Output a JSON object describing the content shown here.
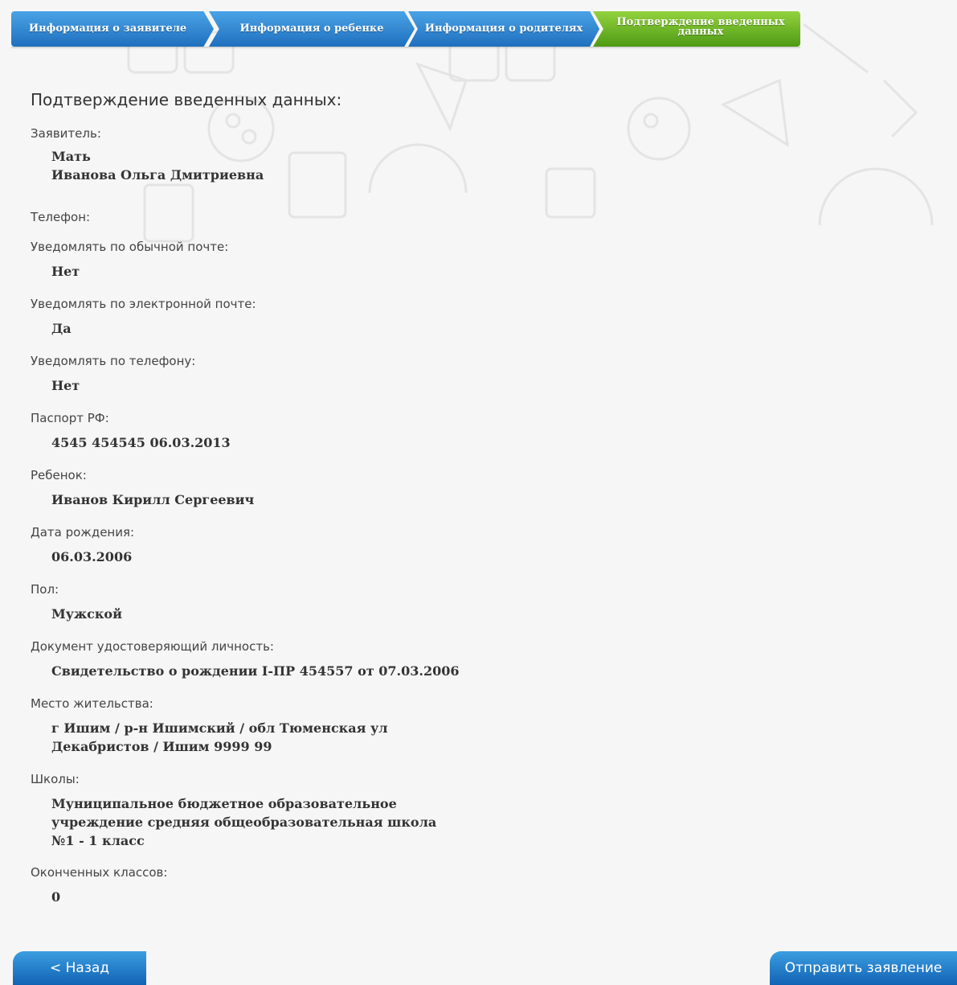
{
  "wizard": {
    "steps": [
      {
        "label": "Информация о заявителе",
        "state": "done",
        "color": "#1f6fbe"
      },
      {
        "label": "Информация о ребенке",
        "state": "done",
        "color": "#1f6fbe"
      },
      {
        "label": "Информация о родителях",
        "state": "done",
        "color": "#1f6fbe"
      },
      {
        "label": "Подтверждение введенных\nданных",
        "state": "active",
        "color": "#4e9a14"
      }
    ]
  },
  "page_title": "Подтверждение введенных данных:",
  "fields": [
    {
      "label": "Заявитель:",
      "value": "Мать\nИванова Ольга Дмитриевна"
    },
    {
      "label": "Телефон:",
      "value": ""
    },
    {
      "label": "Уведомлять по обычной почте:",
      "value": "Нет"
    },
    {
      "label": "Уведомлять по электронной почте:",
      "value": "Да"
    },
    {
      "label": "Уведомлять по телефону:",
      "value": "Нет"
    },
    {
      "label": "Паспорт РФ:",
      "value": "4545 454545 06.03.2013"
    },
    {
      "label": "Ребенок:",
      "value": "Иванов Кирилл Сергеевич"
    },
    {
      "label": "Дата рождения:",
      "value": "06.03.2006"
    },
    {
      "label": "Пол:",
      "value": "Мужской"
    },
    {
      "label": "Документ удостоверяющий личность:",
      "value": "Свидетельство о рождении I-ПР 454557 от 07.03.2006"
    },
    {
      "label": "Место жительства:",
      "value": "г Ишим / р-н Ишимский / обл Тюменская ул\nДекабристов / Ишим 9999 99"
    },
    {
      "label": "Школы:",
      "value": "Муниципальное бюджетное образовательное\nучреждение средняя общеобразовательная школа\n№1 - 1 класс"
    },
    {
      "label": "Оконченных классов:",
      "value": "0"
    }
  ],
  "buttons": {
    "back_label": "< Назад",
    "submit_label": "Отправить заявление",
    "color": "#1262b4"
  },
  "colors": {
    "background": "#f6f6f6",
    "step_blue": "#1f6fbe",
    "step_green": "#4e9a14"
  }
}
